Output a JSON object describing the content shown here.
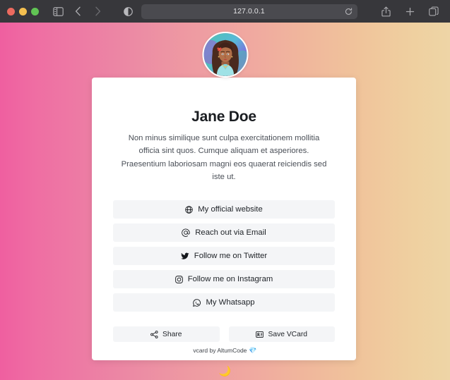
{
  "browser": {
    "traffic_lights": [
      "close",
      "minimize",
      "maximize"
    ],
    "sidebar_label": "Sidebar",
    "back_label": "Back",
    "forward_label": "Forward",
    "reader_label": "Reader view",
    "url": "127.0.0.1",
    "reload_label": "Reload",
    "share_label": "Share",
    "new_tab_label": "New Tab",
    "tab_overview_label": "Tab Overview",
    "colors": {
      "chrome_bg": "#37373b",
      "url_bg": "#4a4a4f",
      "url_text": "#e4e4e6"
    }
  },
  "page": {
    "background_gradient_from": "#ef5fa0",
    "background_gradient_mid": "#f0a9a0",
    "background_gradient_to": "#eed5a6"
  },
  "profile": {
    "avatar_alt": "Illustrated portrait of a woman with long dark wavy hair, a red flower in her hair and a light blue top",
    "name": "Jane Doe",
    "bio": "Non minus similique sunt culpa exercitationem mollitia officia sint quos. Cumque aliquam et asperiores. Praesentium laboriosam magni eos quaerat reiciendis sed iste ut."
  },
  "links": [
    {
      "icon": "globe-icon",
      "label": "My official website"
    },
    {
      "icon": "at-icon",
      "label": "Reach out via Email"
    },
    {
      "icon": "twitter-icon",
      "label": "Follow me on Twitter"
    },
    {
      "icon": "instagram-icon",
      "label": "Follow me on Instagram"
    },
    {
      "icon": "whatsapp-icon",
      "label": "My Whatsapp"
    }
  ],
  "actions": [
    {
      "icon": "share-nodes-icon",
      "label": "Share"
    },
    {
      "icon": "id-card-icon",
      "label": "Save VCard"
    }
  ],
  "footer": {
    "credit_text": "vcard by AltumCode",
    "credit_emoji": "💎",
    "theme_toggle_emoji": "🌙"
  }
}
